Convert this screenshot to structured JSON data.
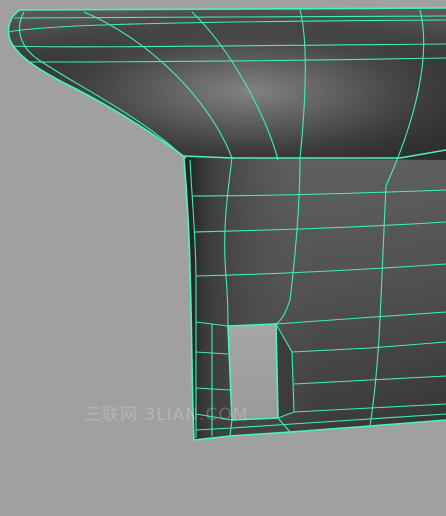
{
  "viewport": {
    "background_color": "#a0a0a0",
    "wire_color": "#3ef0b0",
    "shade_dark": "#2e2e2e",
    "shade_light": "#8a8a8a"
  },
  "watermark": {
    "text": "三联网 3LIAN.COM"
  }
}
